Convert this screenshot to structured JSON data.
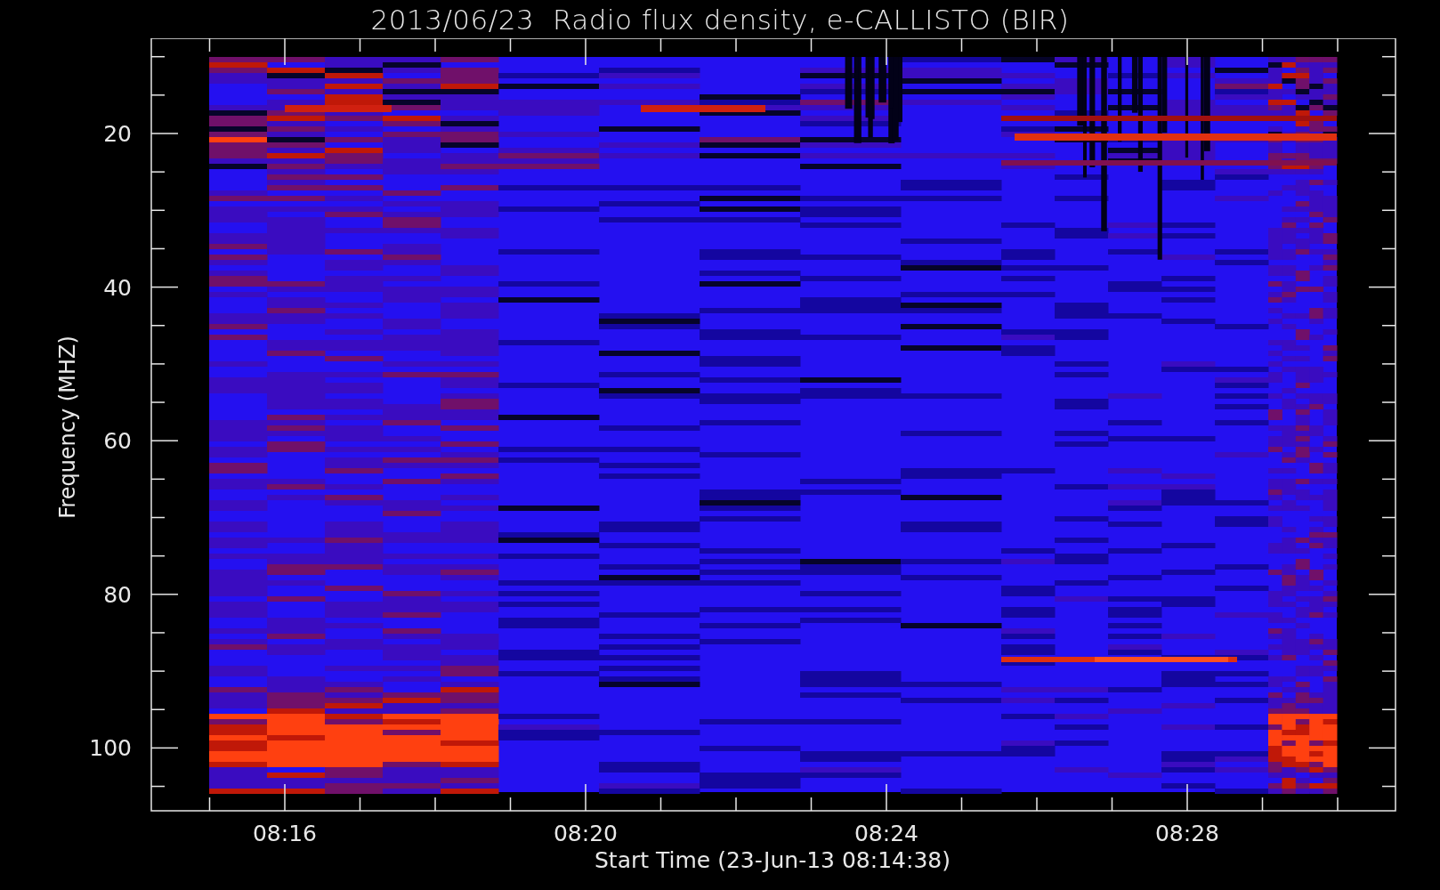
{
  "title": "2013/06/23  Radio flux density, e-CALLISTO (BIR)",
  "y_axis": {
    "label": "Frequency (MHZ)",
    "ticks": [
      "20",
      "40",
      "60",
      "80",
      "100"
    ]
  },
  "x_axis": {
    "label": "Start Time (23-Jun-13 08:14:38)",
    "ticks": [
      "08:16",
      "08:20",
      "08:24",
      "08:28"
    ]
  }
}
